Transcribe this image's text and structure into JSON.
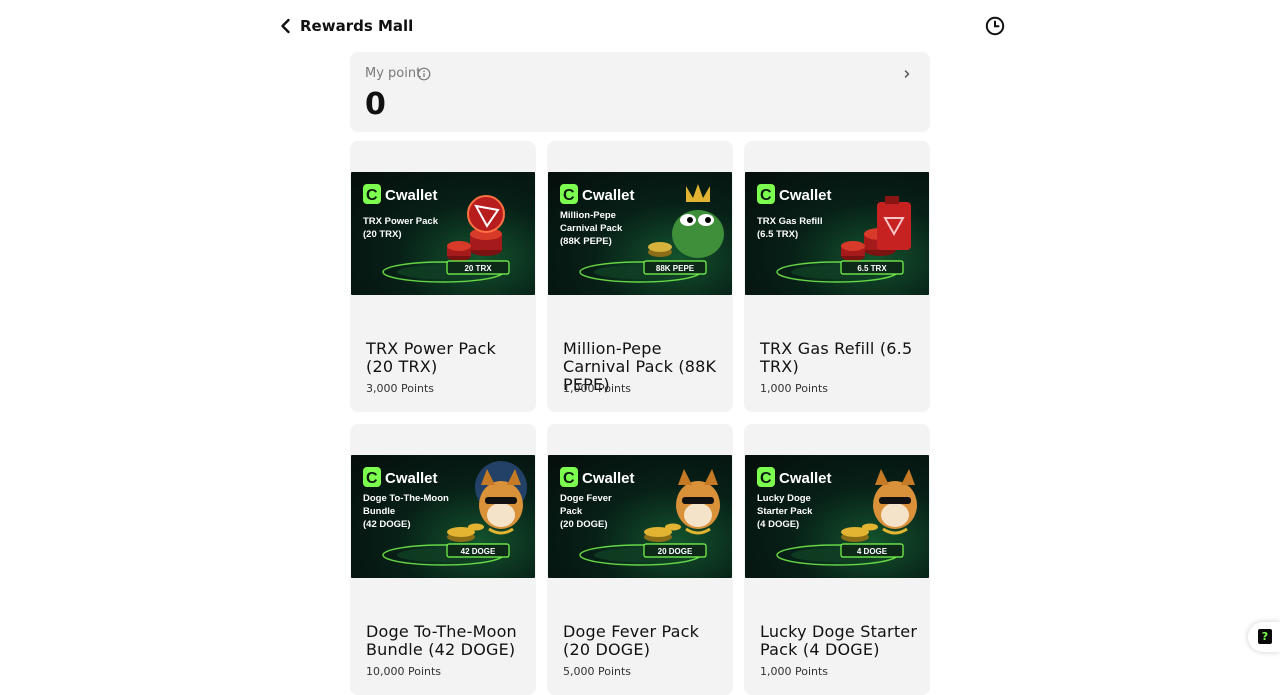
{
  "header": {
    "title": "Rewards Mall",
    "back_icon": "chevron-left-icon",
    "history_icon": "clock-icon"
  },
  "points": {
    "label": "My point",
    "value": "0",
    "info_icon": "info-icon",
    "chevron_icon": "chevron-right-icon"
  },
  "products": [
    {
      "name": "TRX Power Pack (20 TRX)",
      "points": "3,000 Points",
      "image": {
        "brand": "Cwallet",
        "lines": [
          "TRX Power Pack",
          "(20 TRX)"
        ],
        "badge": "20 TRX",
        "accent": "#e23a2a",
        "art": "trx-coins"
      }
    },
    {
      "name": "Million-Pepe Carnival Pack (88K PEPE)",
      "points": "1,000 Points",
      "image": {
        "brand": "Cwallet",
        "lines": [
          "Million-Pepe",
          "Carnival Pack",
          "(88K PEPE)"
        ],
        "badge": "88K PEPE",
        "accent": "#4caf50",
        "art": "pepe"
      }
    },
    {
      "name": "TRX Gas Refill (6.5 TRX)",
      "points": "1,000 Points",
      "image": {
        "brand": "Cwallet",
        "lines": [
          "TRX Gas Refill",
          "(6.5 TRX)"
        ],
        "badge": "6.5 TRX",
        "accent": "#e23a2a",
        "art": "gas-can"
      }
    },
    {
      "name": "Doge To-The-Moon Bundle (42 DOGE)",
      "points": "10,000 Points",
      "image": {
        "brand": "Cwallet",
        "lines": [
          "Doge To-The-Moon",
          "Bundle",
          "(42 DOGE)"
        ],
        "badge": "42 DOGE",
        "accent": "#f0b429",
        "art": "doge-rocket"
      }
    },
    {
      "name": "Doge Fever Pack (20 DOGE)",
      "points": "5,000 Points",
      "image": {
        "brand": "Cwallet",
        "lines": [
          "Doge Fever",
          "Pack",
          "(20 DOGE)"
        ],
        "badge": "20 DOGE",
        "accent": "#f0b429",
        "art": "doge"
      }
    },
    {
      "name": "Lucky Doge Starter Pack (4 DOGE)",
      "points": "1,000 Points",
      "image": {
        "brand": "Cwallet",
        "lines": [
          "Lucky Doge",
          "Starter Pack",
          "(4 DOGE)"
        ],
        "badge": "4 DOGE",
        "accent": "#f0b429",
        "art": "doge"
      }
    }
  ],
  "help": {
    "label": "?",
    "icon": "help-icon"
  },
  "colors": {
    "brand_green": "#7CFF4F",
    "card_bg": "#f3f3f4"
  }
}
